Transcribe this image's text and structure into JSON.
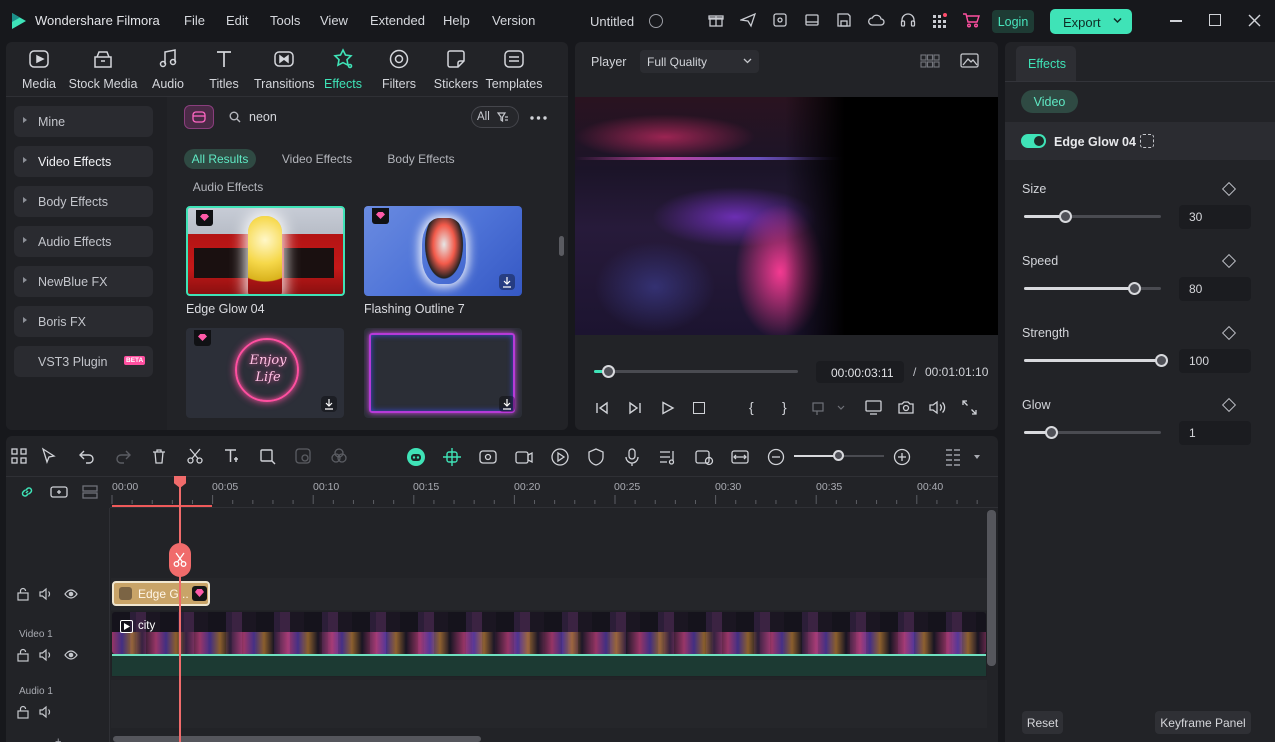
{
  "app": {
    "name": "Wondershare Filmora",
    "project": "Untitled",
    "accent": "#38e0b2",
    "login": "Login",
    "export": "Export"
  },
  "menu": [
    "File",
    "Edit",
    "Tools",
    "View",
    "Extended",
    "Help",
    "Version"
  ],
  "toolbar_tabs": [
    {
      "label": "Media",
      "icon": "media-icon"
    },
    {
      "label": "Stock Media",
      "icon": "stock-media-icon"
    },
    {
      "label": "Audio",
      "icon": "music-note-icon"
    },
    {
      "label": "Titles",
      "icon": "text-icon"
    },
    {
      "label": "Transitions",
      "icon": "transition-icon"
    },
    {
      "label": "Effects",
      "icon": "effects-icon",
      "active": true
    },
    {
      "label": "Filters",
      "icon": "filter-icon"
    },
    {
      "label": "Stickers",
      "icon": "sticker-icon"
    },
    {
      "label": "Templates",
      "icon": "template-icon"
    }
  ],
  "sidebar": [
    "Mine",
    "Video Effects",
    "Body Effects",
    "Audio Effects",
    "NewBlue FX",
    "Boris FX",
    "VST3 Plugin"
  ],
  "sidebar_badge": "BETA",
  "search": {
    "value": "neon",
    "filter": "All"
  },
  "filter_chips": [
    "All Results",
    "Video Effects",
    "Body Effects",
    "Audio Effects"
  ],
  "effects": [
    {
      "name": "Edge Glow 04",
      "premium": true
    },
    {
      "name": "Flashing Outline 7",
      "premium": true
    },
    {
      "name": "",
      "premium": true,
      "art_text": "Enjoy Life"
    },
    {
      "name": "",
      "premium": false
    }
  ],
  "player": {
    "label": "Player",
    "quality": "Full Quality",
    "current_time": "00:00:03:11",
    "separator": "/",
    "total_time": "00:01:01:10",
    "progress": 0.02
  },
  "properties": {
    "tab": "Effects",
    "subtab": "Video",
    "effect_name": "Edge Glow 04",
    "enabled": true,
    "params": [
      {
        "label": "Size",
        "value": "30",
        "fraction": 0.3
      },
      {
        "label": "Speed",
        "value": "80",
        "fraction": 0.8
      },
      {
        "label": "Strength",
        "value": "100",
        "fraction": 1.0
      },
      {
        "label": "Glow",
        "value": "1",
        "fraction": 0.2
      }
    ],
    "reset": "Reset",
    "keyframe": "Keyframe Panel"
  },
  "timeline": {
    "ruler": [
      "00:00",
      "00:05",
      "00:10",
      "00:15",
      "00:20",
      "00:25",
      "00:30",
      "00:35",
      "00:40"
    ],
    "effect_clip": "Edge G...",
    "video_clip": "city",
    "tracks": {
      "video": "Video 1",
      "audio": "Audio 1"
    }
  }
}
